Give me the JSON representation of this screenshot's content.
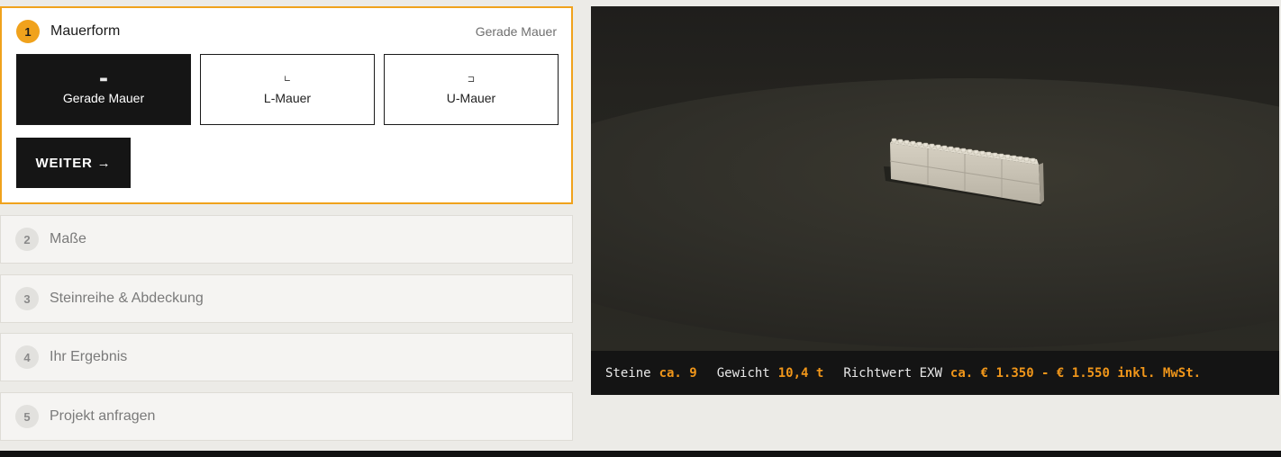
{
  "steps": {
    "active": {
      "number": "1",
      "title": "Mauerform",
      "selected_value": "Gerade Mauer",
      "options": [
        {
          "icon": "▬",
          "label": "Gerade Mauer"
        },
        {
          "icon": "∟",
          "label": "L-Mauer"
        },
        {
          "icon": "⊐",
          "label": "U-Mauer"
        }
      ],
      "next_label": "WEITER →"
    },
    "items": [
      {
        "number": "2",
        "label": "Maße"
      },
      {
        "number": "3",
        "label": "Steinreihe & Abdeckung"
      },
      {
        "number": "4",
        "label": "Ihr Ergebnis"
      },
      {
        "number": "5",
        "label": "Projekt anfragen"
      }
    ]
  },
  "summary": {
    "stones_label": "Steine",
    "stones_value": "ca. 9",
    "weight_label": "Gewicht",
    "weight_value": "10,4 t",
    "price_label": "Richtwert EXW",
    "price_value": "ca. € 1.350 - € 1.550 inkl. MwSt."
  },
  "colors": {
    "accent": "#f0a21c",
    "price": "#f0961a",
    "dark": "#151515"
  }
}
